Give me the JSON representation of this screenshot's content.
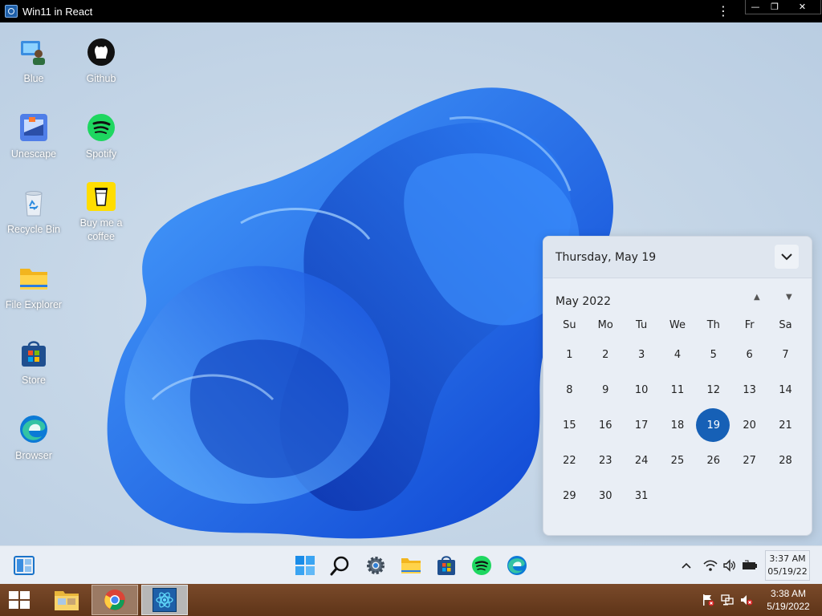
{
  "window": {
    "title": "Win11 in React"
  },
  "desktop_icons": [
    {
      "label": "Blue",
      "icon": "blue-user-icon"
    },
    {
      "label": "Github",
      "icon": "github-icon"
    },
    {
      "label": "Unescape",
      "icon": "unescape-icon"
    },
    {
      "label": "Spotify",
      "icon": "spotify-icon"
    },
    {
      "label": "Recycle Bin",
      "icon": "recycle-bin-icon"
    },
    {
      "label": "Buy me a coffee",
      "icon": "coffee-cup-icon"
    },
    {
      "label": "File Explorer",
      "icon": "folder-icon"
    },
    {
      "label": "Store",
      "icon": "store-icon"
    },
    {
      "label": "Browser",
      "icon": "edge-icon"
    }
  ],
  "calendar": {
    "header_date": "Thursday, May 19",
    "month_label": "May 2022",
    "weekdays": [
      "Su",
      "Mo",
      "Tu",
      "We",
      "Th",
      "Fr",
      "Sa"
    ],
    "weeks": [
      [
        "1",
        "2",
        "3",
        "4",
        "5",
        "6",
        "7"
      ],
      [
        "8",
        "9",
        "10",
        "11",
        "12",
        "13",
        "14"
      ],
      [
        "15",
        "16",
        "17",
        "18",
        "19",
        "20",
        "21"
      ],
      [
        "22",
        "23",
        "24",
        "25",
        "26",
        "27",
        "28"
      ],
      [
        "29",
        "30",
        "31",
        "",
        "",
        "",
        ""
      ]
    ],
    "today": "19",
    "accent": "#1660b6"
  },
  "taskbar": {
    "items": [
      "widgets-icon",
      "start-icon",
      "search-icon",
      "settings-icon",
      "file-explorer-icon",
      "store-icon",
      "spotify-icon",
      "edge-icon"
    ],
    "tray": [
      "chevron-up-icon",
      "wifi-icon",
      "volume-icon",
      "battery-icon"
    ],
    "clock_time": "3:37 AM",
    "clock_date": "05/19/22"
  },
  "host_taskbar": {
    "clock_time": "3:38 AM",
    "clock_date": "5/19/2022",
    "items": [
      "windows-start-icon",
      "file-manager-icon",
      "chrome-icon",
      "react-app-icon"
    ]
  }
}
